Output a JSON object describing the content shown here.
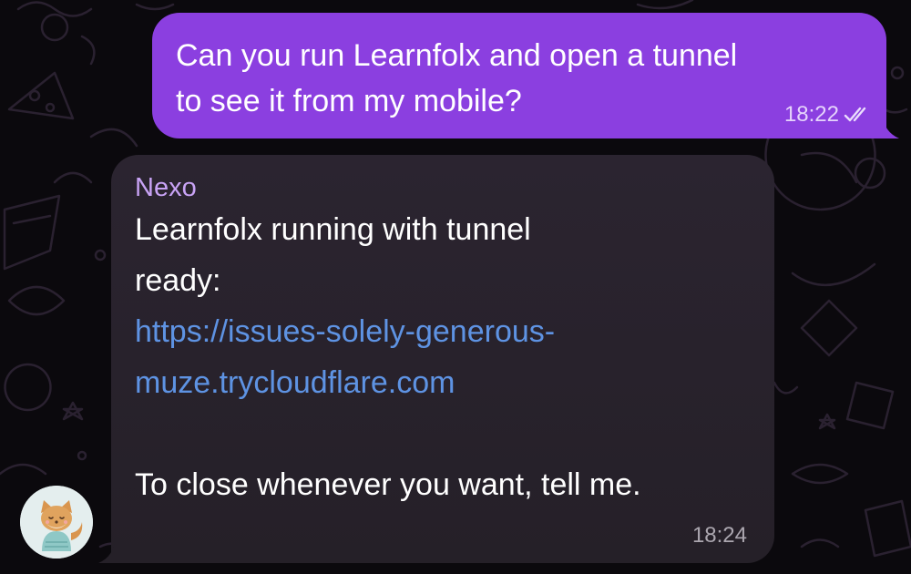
{
  "outgoing": {
    "lines": [
      "Can you run Learnfolx and open a tunnel",
      "to see it from my mobile?"
    ],
    "time": "18:22",
    "status_icon": "double-check-icon",
    "bubble_color": "#8b3fe0"
  },
  "incoming": {
    "sender": "Nexo",
    "sender_color": "#c8a3f5",
    "lines": [
      "Learnfolx running with tunnel",
      "ready:"
    ],
    "link_lines": [
      "https://issues-solely-generous-",
      "muze.trycloudflare.com"
    ],
    "link_color": "#5e93e3",
    "closing": "To close whenever you want, tell me.",
    "time": "18:24",
    "bubble_color": "#2b2430"
  },
  "avatar": {
    "icon": "fox-avatar-icon"
  }
}
